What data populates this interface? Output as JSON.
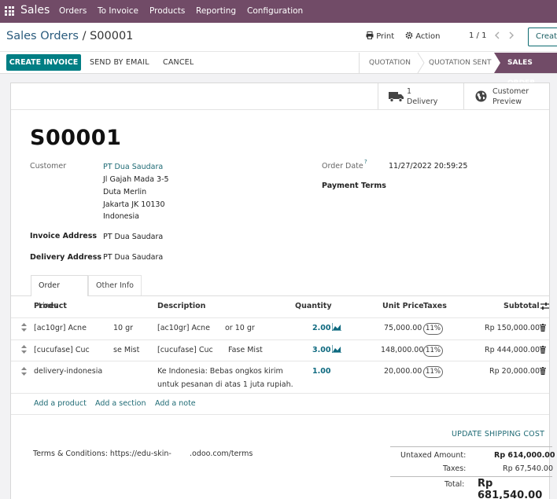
{
  "navbar": {
    "brand": "Sales",
    "menu": [
      "Orders",
      "To Invoice",
      "Products",
      "Reporting",
      "Configuration"
    ]
  },
  "control_panel": {
    "breadcrumb_parent": "Sales Orders",
    "breadcrumb_sep": "/",
    "breadcrumb_current": "S00001",
    "print_label": "Print",
    "action_label": "Action",
    "pager": "1 / 1",
    "create_label": "Create"
  },
  "buttons": {
    "create_invoice": "CREATE INVOICE",
    "send_by_email": "SEND BY EMAIL",
    "cancel": "CANCEL"
  },
  "statusbar": {
    "quotation": "QUOTATION",
    "quotation_sent": "QUOTATION SENT",
    "sales_order": "SALES ORDER"
  },
  "smart_buttons": {
    "delivery_count": "1",
    "delivery_label": "Delivery",
    "customer_label1": "Customer",
    "customer_label2": "Preview"
  },
  "order": {
    "name": "S00001",
    "customer_label": "Customer",
    "customer_name": "PT Dua Saudara",
    "address": [
      "Jl Gajah Mada 3-5",
      "Duta Merlin",
      "Jakarta JK 10130",
      "Indonesia"
    ],
    "invoice_address_label": "Invoice Address",
    "invoice_address": "PT Dua Saudara",
    "delivery_address_label": "Delivery Address",
    "delivery_address": "PT Dua Saudara",
    "order_date_label": "Order Date",
    "order_date_help": "?",
    "order_date": "11/27/2022 20:59:25",
    "payment_terms_label": "Payment Terms"
  },
  "tabs": [
    "Order Lines",
    "Other Info"
  ],
  "table": {
    "headers": {
      "product": "Product",
      "description": "Description",
      "quantity": "Quantity",
      "unit_price": "Unit Price",
      "taxes": "Taxes",
      "subtotal": "Subtotal"
    },
    "rows": [
      {
        "product": "[ac10gr] Acne",
        "product_tail": "10 gr",
        "description": "[ac10gr] Acne",
        "description_tail": "or 10 gr",
        "quantity": "2.00",
        "unit_price": "75,000.00",
        "tax": "11%",
        "subtotal": "Rp 150,000.00"
      },
      {
        "product": "[cucufase] Cuc",
        "product_tail": "se Mist",
        "description": "[cucufase] Cuc",
        "description_tail": "Fase Mist",
        "quantity": "3.00",
        "unit_price": "148,000.00",
        "tax": "11%",
        "subtotal": "Rp 444,000.00"
      },
      {
        "product": "delivery-indonesia",
        "description_line1": "Ke Indonesia: Bebas ongkos kirim",
        "description_line2": "untuk pesanan di atas 1 juta rupiah.",
        "quantity": "1.00",
        "unit_price": "20,000.00",
        "tax": "11%",
        "subtotal": "Rp 20,000.00"
      }
    ],
    "add_product": "Add a product",
    "add_section": "Add a section",
    "add_note": "Add a note"
  },
  "footer": {
    "update_shipping": "UPDATE SHIPPING COST",
    "terms_prefix": "Terms & Conditions: https://edu-skin-",
    "terms_suffix": ".odoo.com/terms",
    "untaxed_label": "Untaxed Amount:",
    "untaxed_value": "Rp 614,000.00",
    "taxes_label": "Taxes:",
    "taxes_value": "Rp 67,540.00",
    "total_label": "Total:",
    "total_value": "Rp 681,540.00"
  },
  "colors": {
    "brand": "#714b67",
    "primary": "#017e84",
    "link": "#1f6b75"
  }
}
